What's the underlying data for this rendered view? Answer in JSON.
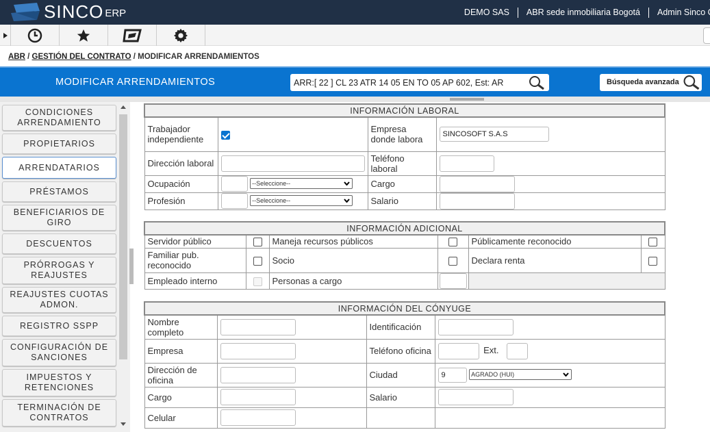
{
  "app": {
    "logo_text": "SINCO",
    "logo_suffix": "ERP"
  },
  "topnav": [
    "DEMO SAS",
    "ABR sede inmobiliaria Bogotá",
    "Admin Sinco C"
  ],
  "toolbar": {
    "icons": [
      "history-icon",
      "star-icon",
      "module-icon",
      "gear-icon"
    ]
  },
  "breadcrumb": {
    "root": "ABR",
    "section": "GESTIÓN DEL CONTRATO",
    "current": "MODIFICAR ARRENDAMIENTOS"
  },
  "header": {
    "title": "MODIFICAR ARRENDAMIENTOS",
    "search_value": "ARR:[ 22 ] CL 23 ATR 14 05 EN TO 05 AP 602, Est: AR",
    "advanced_search": "Búsqueda avanzada"
  },
  "sidebar": {
    "items": [
      {
        "label": "CONDICIONES ARRENDAMIENTO"
      },
      {
        "label": "PROPIETARIOS"
      },
      {
        "label": "ARRENDATARIOS"
      },
      {
        "label": "PRÉSTAMOS"
      },
      {
        "label": "BENEFICIARIOS DE GIRO"
      },
      {
        "label": "DESCUENTOS"
      },
      {
        "label": "PRÓRROGAS Y REAJUSTES"
      },
      {
        "label": "REAJUSTES CUOTAS ADMON."
      },
      {
        "label": "REGISTRO SSPP"
      },
      {
        "label": "CONFIGURACIÓN DE SANCIONES"
      },
      {
        "label": "IMPUESTOS Y RETENCIONES"
      },
      {
        "label": "TERMINACIÓN DE CONTRATOS"
      }
    ]
  },
  "laboral": {
    "title": "INFORMACIÓN LABORAL",
    "independiente": "Trabajador independiente",
    "empresa": "Empresa donde labora",
    "empresa_value": "SINCOSOFT S.A.S",
    "direccion": "Dirección laboral",
    "telefono": "Teléfono laboral",
    "ocupacion": "Ocupación",
    "cargo": "Cargo",
    "profesion": "Profesión",
    "salario": "Salario",
    "select_placeholder": "--Seleccione--"
  },
  "adicional": {
    "title": "INFORMACIÓN ADICIONAL",
    "servidor": "Servidor público",
    "maneja": "Maneja recursos públicos",
    "reconocido": "Públicamente reconocido",
    "familiar": "Familiar pub. reconocido",
    "socio": "Socio",
    "renta": "Declara renta",
    "empleado": "Empleado interno",
    "personas": "Personas a cargo"
  },
  "conyuge": {
    "title": "INFORMACIÓN DEL CÓNYUGE",
    "nombre": "Nombre completo",
    "identificacion": "Identificación",
    "empresa": "Empresa",
    "telefono": "Teléfono oficina",
    "ext": "Ext.",
    "direccion": "Dirección de oficina",
    "ciudad": "Ciudad",
    "ciudad_code": "9",
    "ciudad_value": "AGRADO (HUI)",
    "cargo": "Cargo",
    "salario": "Salario",
    "celular": "Celular"
  }
}
